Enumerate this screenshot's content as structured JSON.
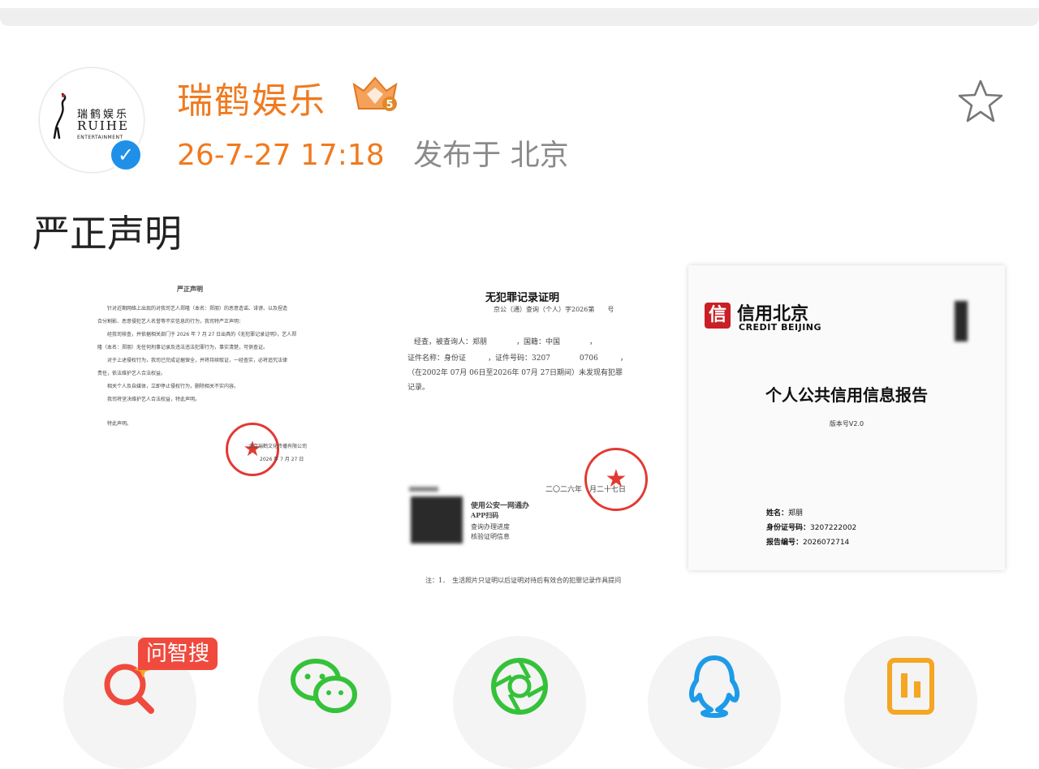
{
  "header": {
    "avatar": {
      "brand_cn": "瑞鹤娱乐",
      "brand_en": "RUIHE",
      "brand_sub": "ENTERTAINMENT"
    },
    "user_name": "瑞鹤娱乐",
    "vip_level": "5",
    "post_time": "26-7-27 17:18",
    "post_location": "发布于 北京",
    "favorite_icon": "star-outline-icon"
  },
  "post": {
    "headline": "严正声明"
  },
  "documents": {
    "statement": {
      "title": "严正声明",
      "lines": [
        "针对近期网络上出现的对我司艺人郑隆（本名：郑朋）的恶意造谣、诽谤、以及捏造",
        "合分割影、恶意侵犯艺人名誉等不实信息的行为，我司特严正声明：",
        "经我司核查，并依据相关部门于 2026 年 7 月 27 日出具的《无犯罪记录证明》，艺人郑",
        "隆（本名：郑朋）无任何刑事记录及违法违法犯罪行为，事实清楚，可供查证。",
        "对于上述侵权行为，我司已完成证据保全，并将持续取证，一经查实，必将追究法律",
        "责任，依法维护艺人合法权益。",
        "相关个人及自媒体，立即停止侵权行为，删除相关不实内容。",
        "我司将坚决维护艺人合法权益，特此声明。",
        "特此声明。"
      ],
      "sign_company": "北京瑞鹤文化传播有限公司",
      "sign_date": "2026 年 7 月 27 日"
    },
    "clearance": {
      "title": "无犯罪记录证明",
      "ref": "京公（通）查询（个人）字2026第　　号",
      "line1": "经查，被查询人：郑朋　　　　，国籍：中国　　　　，",
      "line2": "证件名称：身份证　　　，证件号码：3207　　　　0706　　　，",
      "line3": "（在2002年 07月 06日至2026年 07月 27日期间）未发现有犯罪",
      "line4": "记录。",
      "date": "二〇二六年　月二十七日",
      "qr_title": "使用公安一网通办",
      "qr_sub1": "APP扫码",
      "qr_sub2": "查询办理进度",
      "qr_sub3": "核验证明信息",
      "footnote": "注：1．　生活照片只证明以后证明对待后有效合的犯罪记录作具提问"
    },
    "credit": {
      "logo_cn": "信用北京",
      "logo_en": "CREDIT BEIJING",
      "title": "个人公共信用信息报告",
      "version": "版本号V2.0",
      "name_label": "姓名：",
      "name_value": "郑朋",
      "id_label": "身份证号码：",
      "id_value": "3207222002",
      "report_label": "报告编号：",
      "report_value": "2026072714"
    }
  },
  "share_bar": {
    "ai_search_tag": "问智搜",
    "buttons": [
      {
        "name": "ai-search",
        "icon": "ai-search-icon",
        "color": "#f04a3e"
      },
      {
        "name": "wechat",
        "icon": "wechat-icon",
        "color": "#35c23a"
      },
      {
        "name": "moments",
        "icon": "moments-icon",
        "color": "#35c23a"
      },
      {
        "name": "qq",
        "icon": "qq-icon",
        "color": "#1e9be8"
      },
      {
        "name": "more",
        "icon": "app-icon",
        "color": "#f5a623"
      }
    ]
  },
  "colors": {
    "accent": "#f07a1f",
    "verified": "#1e90e8",
    "seal": "#e13a34"
  }
}
